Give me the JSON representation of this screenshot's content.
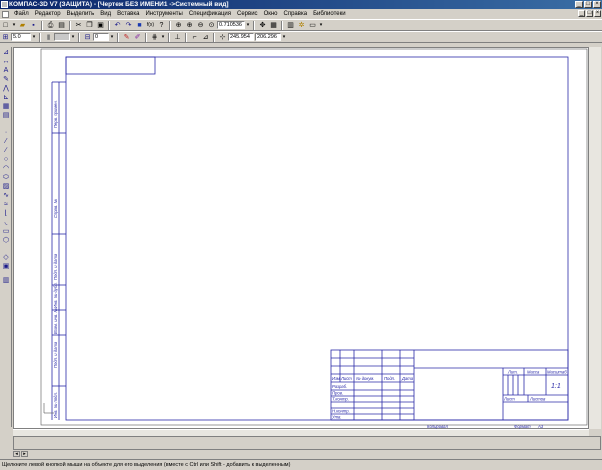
{
  "window": {
    "title": "КОМПАС-3D V7 (ЗАЩИТА) - [Чертеж БЕЗ ИМЕНИ1 ->Системный вид]",
    "min_glyph": "_",
    "max_glyph": "□",
    "close_glyph": "×"
  },
  "menu": {
    "items": [
      "Файл",
      "Редактор",
      "Выделить",
      "Вид",
      "Вставка",
      "Инструменты",
      "Спецификация",
      "Сервис",
      "Окно",
      "Справка",
      "Библиотеки"
    ],
    "mdi_min": "_",
    "mdi_restore": "□",
    "mdi_close": "×"
  },
  "toolbar1": {
    "zoom_value": "0.710536",
    "coord_x": "245.954",
    "coord_y": "206.296"
  },
  "toolbar2": {
    "line_style_value": "5.0",
    "layer_value": "0"
  },
  "title_block": {
    "izm": "Изм.",
    "list": "Лист",
    "doc_no": "№ докум.",
    "podp": "Подп.",
    "data": "Дата",
    "razrab": "Разраб.",
    "prov": "Пров.",
    "t_kontr": "Т.контр.",
    "n_kontr": "Н.контр.",
    "utv": "Утв.",
    "lit": "Лит.",
    "massa": "Масса",
    "masshtab": "Масштаб",
    "scale_value": "1:1",
    "sheet": "Лист",
    "sheets": "Листов",
    "kopiroval": "Копировал",
    "format": "Формат",
    "format_value": "A3"
  },
  "side_stamp": {
    "perv_primen": "Перв. примен.",
    "sprav_no": "Справ. №",
    "podp_i_data": "Подп. и дата",
    "inv_dubl": "Инв. № дубл.",
    "vzam_inv": "Взам. инв. №",
    "podp_i_data2": "Подп. и дата",
    "inv_podl": "Инв. № подл."
  },
  "status": {
    "text": "Щелкните левой кнопкой мыши на объекте для его выделения (вместе с Ctrl или Shift - добавить к выделенным)"
  },
  "colors": {
    "drawing_blue": "#2a2aa8",
    "titlebar": "#0a246a"
  }
}
